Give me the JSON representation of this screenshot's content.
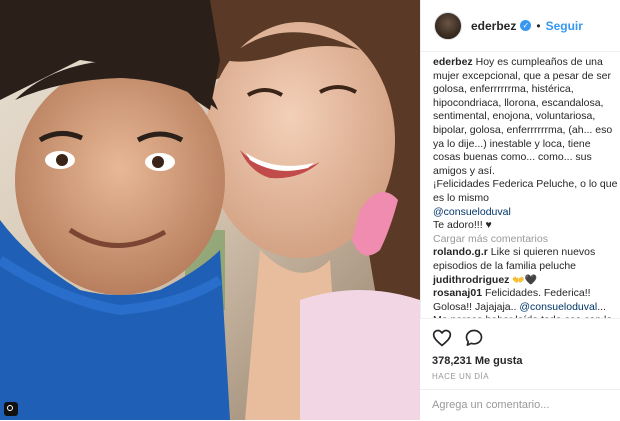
{
  "header": {
    "username": "ederbez",
    "verified_icon": "verified-badge-icon",
    "separator": "•",
    "follow_label": "Seguir"
  },
  "post": {
    "author": "ederbez",
    "caption": "Hoy es cumpleaños de una mujer excepcional, que a pesar de ser golosa, enferrrrrrma, histérica, hipocondriaca, llorona, escandalosa, sentimental, enojona, voluntariosa, bipolar, golosa, enferrrrrrma, (ah... eso ya lo dije...) inestable y loca, tiene cosas buenas como... como... sus amigos y así.",
    "caption_line2": "¡Felicidades Federica Peluche, o lo que es lo mismo",
    "mention": "@consueloduval",
    "closing": "Te adoro!!! ♥"
  },
  "load_more_label": "Cargar más comentarios",
  "comments": [
    {
      "user": "rolando.g.r",
      "text": "Like si quieren nuevos episodios de la familia peluche"
    },
    {
      "user": "judithrodriguez",
      "text": "👐🖤"
    },
    {
      "user": "rosanaj01",
      "text_before": "Felicidades. Federica!! Golosa!! Jajajaja..",
      "mention": "@consueloduval",
      "text_after": "... Me parece haber leído todo eso con la voz de ludovico de fondo 😂"
    }
  ],
  "actions": {
    "like_icon": "heart-icon",
    "comment_icon": "comment-bubble-icon",
    "likes": "378,231 Me gusta",
    "time_ago": "HACE UN DÍA",
    "comment_placeholder": "Agrega un comentario..."
  },
  "colors": {
    "link_blue": "#3897f0",
    "mention_blue": "#003569",
    "muted_gray": "#999999",
    "text_dark": "#262626"
  }
}
